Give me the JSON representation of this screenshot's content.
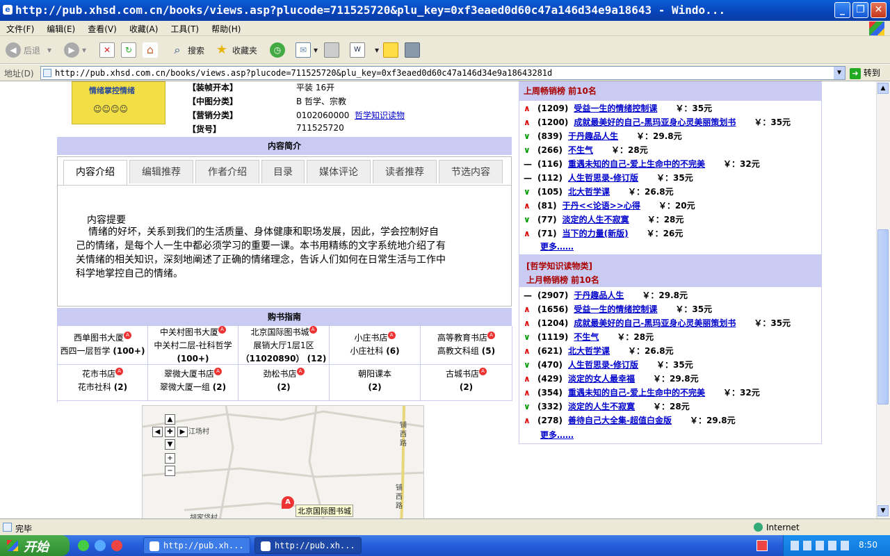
{
  "window": {
    "title": "http://pub.xhsd.com.cn/books/views.asp?plucode=711525720&plu_key=0xf3eaed0d60c47a146d34e9a18643 - Windo..."
  },
  "menu": [
    "文件(F)",
    "编辑(E)",
    "查看(V)",
    "收藏(A)",
    "工具(T)",
    "帮助(H)"
  ],
  "toolbar": {
    "back": "后退",
    "search": "搜索",
    "favorites": "收藏夹"
  },
  "address": {
    "label": "地址(D)",
    "url": "http://pub.xhsd.com.cn/books/views.asp?plucode=711525720&plu_key=0xf3eaed0d60c47a146d34e9a18643281d",
    "go": "转到"
  },
  "book": {
    "rows": [
      {
        "label": "【装帧开本】",
        "value": "平装   16开",
        "link": ""
      },
      {
        "label": "【中图分类】",
        "value": "B  哲学、宗教",
        "link": ""
      },
      {
        "label": "【营销分类】",
        "value": "0102060000",
        "link": "哲学知识读物"
      },
      {
        "label": "【货号】",
        "value": "711525720",
        "link": ""
      }
    ],
    "cover_text": "情绪掌控情绪"
  },
  "intro": {
    "header": "内容简介",
    "tabs": [
      "内容介绍",
      "编辑推荐",
      "作者介绍",
      "目录",
      "媒体评论",
      "读者推荐",
      "节选内容"
    ],
    "title": "内容提要",
    "lines": [
      "情绪的好坏，关系到我们的生活质量、身体健康和职场发展，因此，学会控制好自",
      "己的情绪，是每个人一生中都必须学习的重要一课。本书用精练的文字系统地介绍了有",
      "关情绪的相关知识，深刻地阐述了正确的情绪理念，告诉人们如何在日常生活与工作中",
      "科学地掌控自己的情绪。"
    ]
  },
  "stores": {
    "header": "购书指南",
    "cells": [
      {
        "l1": "西单图书大厦",
        "l2": "西四一层哲学",
        "n": "(100+)",
        "badge": true
      },
      {
        "l1": "中关村图书大厦",
        "l2": "中关村二层-社科哲学",
        "n": "(100+)",
        "badge": true
      },
      {
        "l1": "北京国际图书城",
        "l2": "展销大厅1层1区",
        "n": "（11020890） (12)",
        "badge": true
      },
      {
        "l1": "小庄书店",
        "l2": "小庄社科",
        "n": "(6)",
        "badge": true
      },
      {
        "l1": "高等教育书店",
        "l2": "高教文科组",
        "n": "(5)",
        "badge": true
      },
      {
        "l1": "花市书店",
        "l2": "花市社科",
        "n": "(2)",
        "badge": true
      },
      {
        "l1": "翠微大厦书店",
        "l2": "翠微大厦一组",
        "n": "(2)",
        "badge": true
      },
      {
        "l1": "劲松书店",
        "l2": "",
        "n": "(2)",
        "badge": true
      },
      {
        "l1": "朝阳课本",
        "l2": "",
        "n": "(2)",
        "badge": false
      },
      {
        "l1": "古城书店",
        "l2": "",
        "n": "(2)",
        "badge": true
      }
    ],
    "map": {
      "place1": "江场村",
      "place2": "胡家垡村",
      "road": "铺西路",
      "road2": "铺西路",
      "marker_label": "北京国际图书城",
      "marker": "A"
    }
  },
  "rank1": {
    "title": "上周畅销榜  前10名",
    "items": [
      {
        "t": "up",
        "n": "(1209)",
        "name": "受益一生的情绪控制课",
        "price": "￥：35元"
      },
      {
        "t": "up",
        "n": "(1200)",
        "name": "成就最美好的自己-黑玛亚身心灵美丽策划书",
        "price": "￥：35元"
      },
      {
        "t": "down",
        "n": "(839)",
        "name": "于丹趣品人生",
        "price": "￥：29.8元"
      },
      {
        "t": "down",
        "n": "(266)",
        "name": "不生气",
        "price": "￥：28元"
      },
      {
        "t": "flat",
        "n": "(116)",
        "name": "重遇未知的自己-爱上生命中的不完美",
        "price": "￥：32元"
      },
      {
        "t": "flat",
        "n": "(112)",
        "name": "人生哲思录-修订版",
        "price": "￥：35元"
      },
      {
        "t": "down",
        "n": "(105)",
        "name": "北大哲学课",
        "price": "￥：26.8元"
      },
      {
        "t": "up",
        "n": "(81)",
        "name": "于丹<<论语>>心得",
        "price": "￥：20元"
      },
      {
        "t": "down",
        "n": "(77)",
        "name": "淡定的人生不寂寞",
        "price": "￥：28元"
      },
      {
        "t": "up",
        "n": "(71)",
        "name": "当下的力量(新版)",
        "price": "￥：26元"
      }
    ],
    "more": "更多……"
  },
  "rank2": {
    "category": "[哲学知识读物类]",
    "title": "上月畅销榜  前10名",
    "items": [
      {
        "t": "flat",
        "n": "(2907)",
        "name": "于丹趣品人生",
        "price": "￥：29.8元"
      },
      {
        "t": "up",
        "n": "(1656)",
        "name": "受益一生的情绪控制课",
        "price": "￥：35元"
      },
      {
        "t": "up",
        "n": "(1204)",
        "name": "成就最美好的自己-黑玛亚身心灵美丽策划书",
        "price": "￥：35元"
      },
      {
        "t": "down",
        "n": "(1119)",
        "name": "不生气",
        "price": "￥：28元"
      },
      {
        "t": "up",
        "n": "(621)",
        "name": "北大哲学课",
        "price": "￥：26.8元"
      },
      {
        "t": "down",
        "n": "(470)",
        "name": "人生哲思录-修订版",
        "price": "￥：35元"
      },
      {
        "t": "up",
        "n": "(429)",
        "name": "淡定的女人最幸福",
        "price": "￥：29.8元"
      },
      {
        "t": "up",
        "n": "(354)",
        "name": "重遇未知的自己-爱上生命中的不完美",
        "price": "￥：32元"
      },
      {
        "t": "down",
        "n": "(332)",
        "name": "淡定的人生不寂寞",
        "price": "￥：28元"
      },
      {
        "t": "up",
        "n": "(278)",
        "name": "善待自己大全集-超值白金版",
        "price": "￥：29.8元"
      }
    ],
    "more": "更多……"
  },
  "status": {
    "text": "完毕",
    "zone": "Internet"
  },
  "taskbar": {
    "start": "开始",
    "tasks": [
      "http://pub.xh...",
      "http://pub.xh..."
    ],
    "time": "8:50"
  },
  "colors": {
    "accent": "#c9cbf3",
    "up": "#dd0000",
    "down": "#009900",
    "link": "#0000cc"
  }
}
